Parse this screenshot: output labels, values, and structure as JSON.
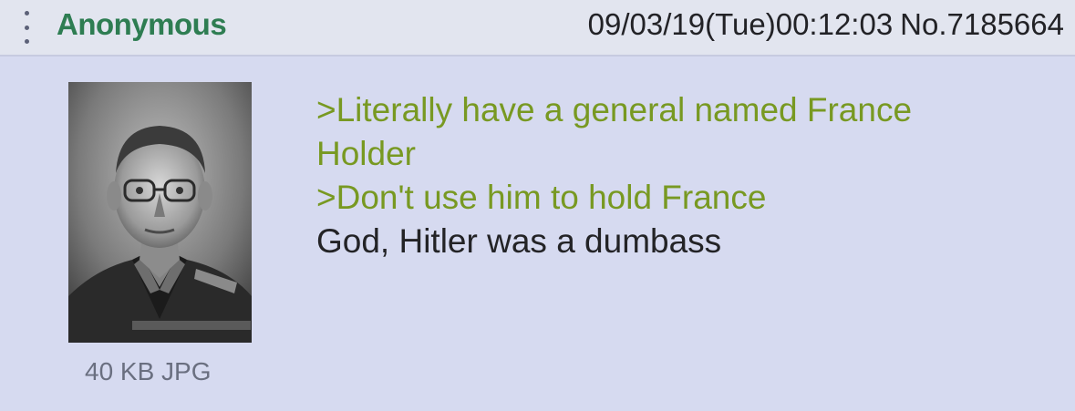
{
  "post": {
    "name": "Anonymous",
    "datetime": "09/03/19(Tue)00:12:03",
    "post_number": "No.7185664",
    "file_info": "40 KB JPG",
    "thumbnail_description_icon": "portrait-photo",
    "lines": [
      {
        "text": ">Literally have a general named France",
        "type": "greentext"
      },
      {
        "text": "Holder",
        "type": "greentext"
      },
      {
        "text": ">Don't use him to hold France",
        "type": "greentext"
      },
      {
        "text": "God, Hitler was a dumbass",
        "type": "normal"
      }
    ]
  },
  "colors": {
    "name": "#2e7d52",
    "greentext": "#789922",
    "background": "#d6daf0",
    "header": "#e2e5ef"
  },
  "icons": {
    "menu": "more-vertical-icon"
  }
}
